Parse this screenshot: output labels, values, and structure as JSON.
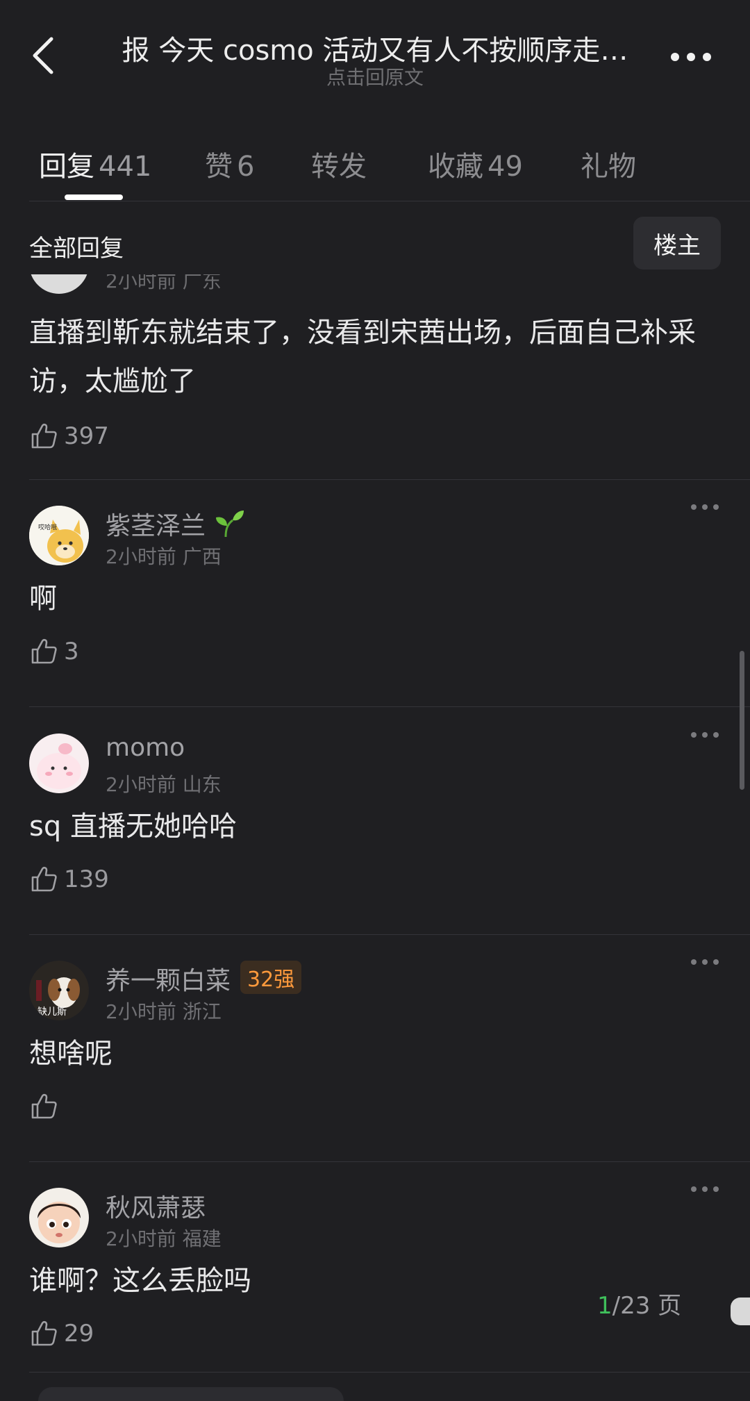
{
  "header": {
    "title": "报  今天 cosmo 活动又有人不按顺序走…",
    "subtitle": "点击回原文"
  },
  "tabs": [
    {
      "label": "回复",
      "count": "441",
      "active": true
    },
    {
      "label": "赞",
      "count": "6",
      "active": false
    },
    {
      "label": "转发",
      "count": "",
      "active": false
    },
    {
      "label": "收藏",
      "count": "49",
      "active": false
    },
    {
      "label": "礼物",
      "count": "",
      "active": false
    }
  ],
  "filter": {
    "all_replies": "全部回复",
    "op_only": "楼主"
  },
  "first_comment": {
    "meta": "2小时前 广东",
    "text": "直播到靳东就结束了，没看到宋茜出场，后面自己补采访，太尴尬了",
    "likes": "397"
  },
  "comments": [
    {
      "username": "紫茎泽兰",
      "meta": "2小时前 广西",
      "text": "啊",
      "likes": "3",
      "avatar": "shiba-avatar",
      "avatar_text": "哎哈哦"
    },
    {
      "username": "momo",
      "meta": "2小时前 山东",
      "text": "sq 直播无她哈哈",
      "likes": "139",
      "avatar": "pink-blob-avatar"
    },
    {
      "username": "养一颗白菜",
      "badge": "32强",
      "meta": "2小时前 浙江",
      "text": "想啥呢",
      "likes": "",
      "avatar": "dog-photo-avatar",
      "avatar_text": "缺儿斯"
    },
    {
      "username": "秋风萧瑟",
      "meta": "2小时前 福建",
      "text": "谁啊？这么丢脸吗",
      "likes": "29",
      "avatar": "cartoon-girl-avatar"
    }
  ],
  "pagination": {
    "current": "1",
    "rest": "/23 页"
  },
  "colors": {
    "background": "#1f1f22",
    "accent_green": "#3fbf5b",
    "badge_orange": "#ff9a3c"
  }
}
